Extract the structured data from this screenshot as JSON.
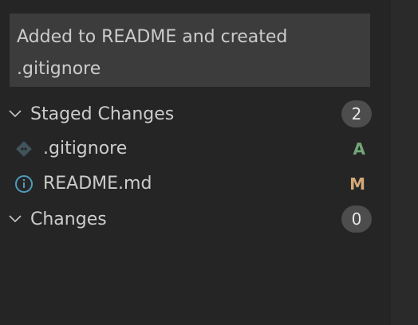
{
  "commit_message": "Added to README and created\n.gitignore",
  "staged": {
    "label": "Staged Changes",
    "count": "2",
    "files": [
      {
        "name": ".gitignore",
        "status": "A",
        "status_color": "#73a776",
        "icon": "git-diamond-icon"
      },
      {
        "name": "README.md",
        "status": "M",
        "status_color": "#d3a777",
        "icon": "info-icon"
      }
    ]
  },
  "changes": {
    "label": "Changes",
    "count": "0"
  }
}
